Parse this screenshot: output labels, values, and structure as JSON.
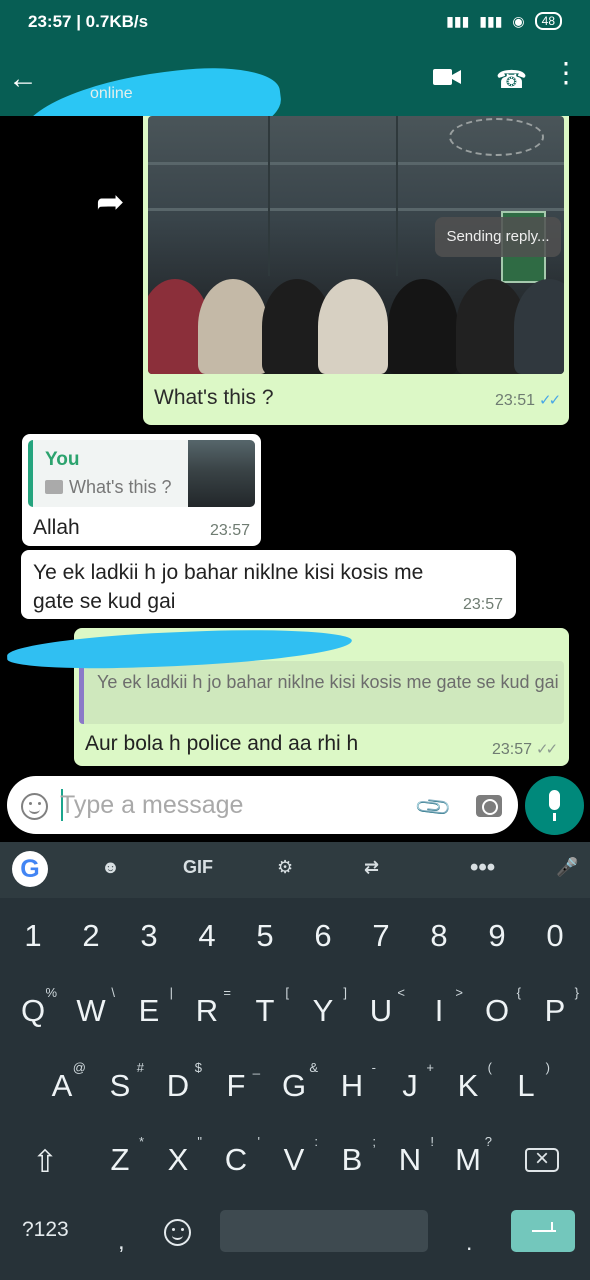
{
  "status_bar": {
    "time_speed": "23:57 | 0.7KB/s",
    "battery": "48",
    "icons": [
      "signal-icon",
      "signal-icon",
      "wifi-icon",
      "battery-icon"
    ]
  },
  "header": {
    "contact_status": "online"
  },
  "messages": {
    "image_caption": "What's this ?",
    "image_time": "23:51",
    "toast": "Sending reply...",
    "reply_quote_title": "You",
    "reply_quote_text": "What's this ?",
    "reply_message": "Allah",
    "reply_time": "23:57",
    "incoming_text": "Ye ek ladkii h jo bahar niklne kisi kosis me gate se kud gai",
    "incoming_time": "23:57",
    "outgoing_quote": "Ye ek ladkii h jo bahar niklne kisi kosis me gate se kud gai",
    "outgoing_message": "Aur bola h police and aa rhi h",
    "outgoing_time": "23:57"
  },
  "composer": {
    "placeholder": "Type a message"
  },
  "keyboard": {
    "top_tools": [
      "G",
      "GIF"
    ],
    "number_row": [
      "1",
      "2",
      "3",
      "4",
      "5",
      "6",
      "7",
      "8",
      "9",
      "0"
    ],
    "row_1": [
      {
        "main": "Q",
        "sub": "%"
      },
      {
        "main": "W",
        "sub": "\\"
      },
      {
        "main": "E",
        "sub": "|"
      },
      {
        "main": "R",
        "sub": "="
      },
      {
        "main": "T",
        "sub": "["
      },
      {
        "main": "Y",
        "sub": "]"
      },
      {
        "main": "U",
        "sub": "<"
      },
      {
        "main": "I",
        "sub": ">"
      },
      {
        "main": "O",
        "sub": "{"
      },
      {
        "main": "P",
        "sub": "}"
      }
    ],
    "row_2": [
      {
        "main": "A",
        "sub": "@"
      },
      {
        "main": "S",
        "sub": "#"
      },
      {
        "main": "D",
        "sub": "$"
      },
      {
        "main": "F",
        "sub": "_"
      },
      {
        "main": "G",
        "sub": "&"
      },
      {
        "main": "H",
        "sub": "-"
      },
      {
        "main": "J",
        "sub": "+"
      },
      {
        "main": "K",
        "sub": "("
      },
      {
        "main": "L",
        "sub": ")"
      }
    ],
    "row_3": [
      {
        "main": "Z",
        "sub": "*"
      },
      {
        "main": "X",
        "sub": "\""
      },
      {
        "main": "C",
        "sub": "'"
      },
      {
        "main": "V",
        "sub": ":"
      },
      {
        "main": "B",
        "sub": ";"
      },
      {
        "main": "N",
        "sub": "!"
      },
      {
        "main": "M",
        "sub": "?"
      }
    ],
    "mode_key": "?123",
    "comma_key": ",",
    "dot_key": "."
  },
  "colors": {
    "whatsapp_green": "#075e54",
    "chat_background": "#000000",
    "outgoing_bubble": "#dcf8c6",
    "incoming_bubble": "#ffffff",
    "accent": "#00897b",
    "read_ticks": "#49a7e6",
    "scribble": "#2bc6f4",
    "keyboard_background": "#273238"
  }
}
